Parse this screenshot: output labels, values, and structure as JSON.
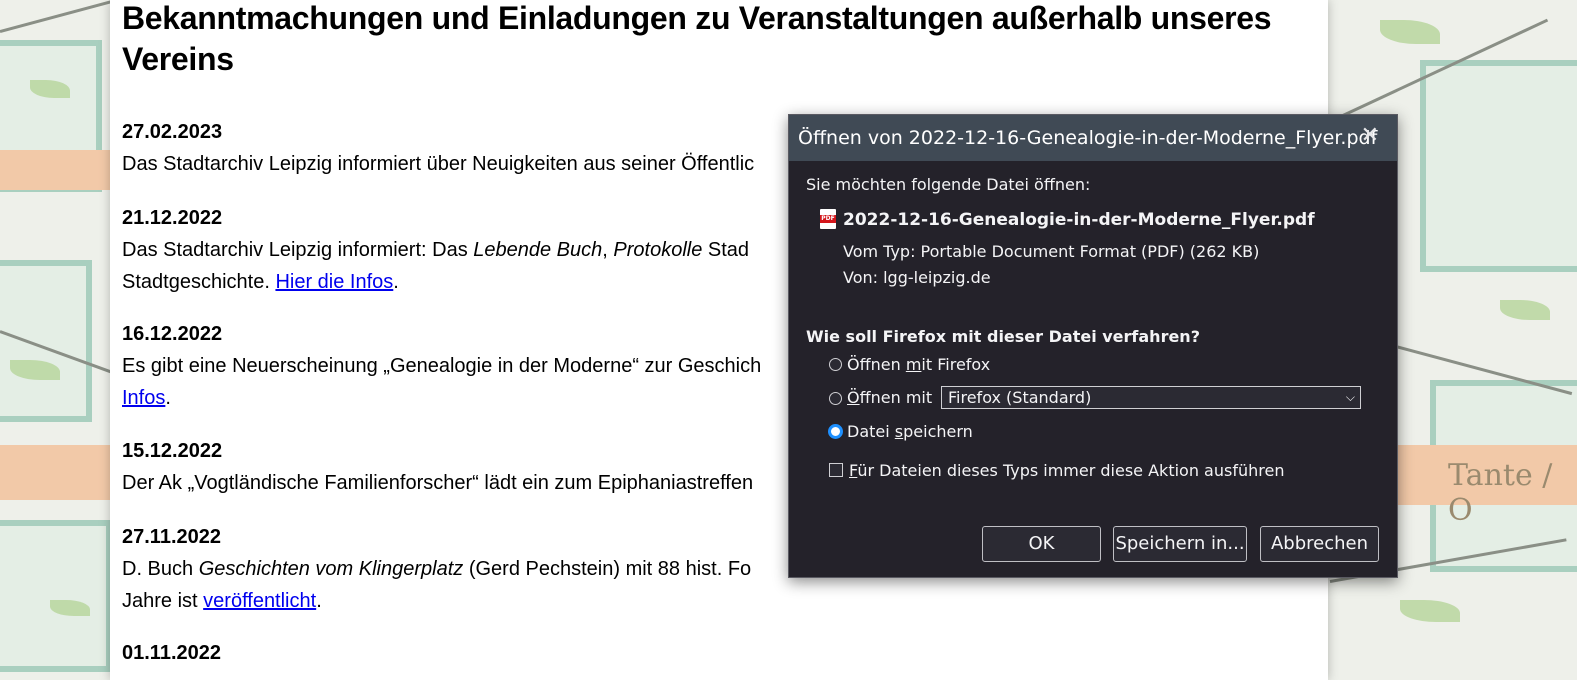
{
  "page": {
    "heading": "Bekanntmachungen und Einladungen zu Veranstaltungen außerhalb unseres Vereins",
    "entries": [
      {
        "date": "27.02.2023",
        "text": "Das Stadtarchiv Leipzig informiert über Neuigkeiten aus seiner Öffentlic"
      },
      {
        "date": "21.12.2022",
        "text_a": "Das Stadtarchiv Leipzig informiert: Das ",
        "em_a": "Lebende Buch",
        "text_b": ", ",
        "em_b": "Protokolle",
        "text_c": " Stad",
        "line2": "Stadtgeschichte. ",
        "link": "Hier die Infos",
        "tail": "."
      },
      {
        "date": "16.12.2022",
        "text": "Es gibt eine Neuerscheinung „Genealogie in der Moderne“ zur Geschich",
        "link": "Infos",
        "tail": "."
      },
      {
        "date": "15.12.2022",
        "text": "Der Ak „Vogtländische Familienforscher“ lädt ein zum Epiphaniastreffen"
      },
      {
        "date": "27.11.2022",
        "text_a": "D. Buch ",
        "em_a": "Geschichten vom Klingerplatz",
        "text_b": " (Gerd Pechstein) mit 88 hist. Fo",
        "line2": "Jahre ist ",
        "link": "veröffentlicht",
        "tail": "."
      },
      {
        "date": "01.11.2022"
      }
    ]
  },
  "background": {
    "label": "Tante / O"
  },
  "dialog": {
    "title": "Öffnen von 2022-12-16-Genealogie-in-der-Moderne_Flyer.pdf",
    "close_glyph": "✕",
    "intro": "Sie möchten folgende Datei öffnen:",
    "file_icon_text": "PDF",
    "filename": "2022-12-16-Genealogie-in-der-Moderne_Flyer.pdf",
    "type_line": "Vom Typ: Portable Document Format (PDF) (262 KB)",
    "from_line": "Von: lgg-leipzig.de",
    "question": "Wie soll Firefox mit dieser Datei verfahren?",
    "options": [
      {
        "pre": "Öffnen ",
        "key": "m",
        "post": "it Firefox",
        "checked": false
      },
      {
        "pre": "",
        "key": "Ö",
        "post": "ffnen mit",
        "checked": false
      },
      {
        "pre": "Datei ",
        "key": "s",
        "post": "peichern",
        "checked": true
      }
    ],
    "app_select": "Firefox (Standard)",
    "always": {
      "key": "F",
      "post": "ür Dateien dieses Typs immer diese Aktion ausführen",
      "checked": false
    },
    "buttons": {
      "ok": "OK",
      "save_in": "Speichern in...",
      "cancel": "Abbrechen"
    }
  }
}
